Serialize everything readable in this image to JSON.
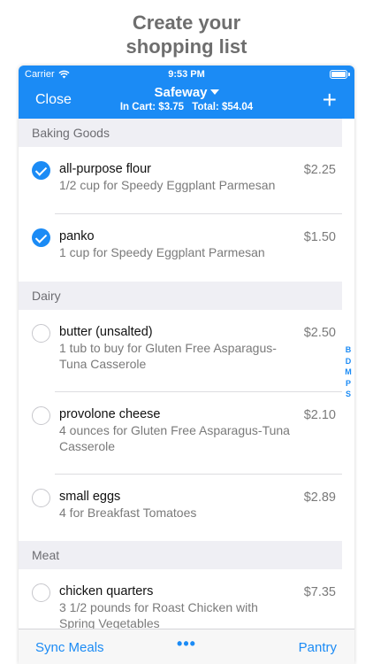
{
  "promo": {
    "line1": "Create your",
    "line2": "shopping list"
  },
  "status": {
    "carrier": "Carrier",
    "time": "9:53 PM"
  },
  "nav": {
    "close_label": "Close",
    "store": "Safeway",
    "in_cart": "In Cart: $3.75",
    "total": "Total: $54.04",
    "add_label": "+"
  },
  "sections": [
    {
      "title": "Baking Goods",
      "items": [
        {
          "name": "all-purpose flour",
          "desc": "1/2 cup for Speedy Eggplant Parmesan",
          "price": "$2.25",
          "checked": true
        },
        {
          "name": "panko",
          "desc": "1 cup for Speedy Eggplant Parmesan",
          "price": "$1.50",
          "checked": true
        }
      ]
    },
    {
      "title": "Dairy",
      "items": [
        {
          "name": "butter (unsalted)",
          "desc": "1 tub to buy for Gluten Free Asparagus-Tuna Casserole",
          "price": "$2.50",
          "checked": false
        },
        {
          "name": "provolone cheese",
          "desc": "4 ounces for Gluten Free Asparagus-Tuna Casserole",
          "price": "$2.10",
          "checked": false
        },
        {
          "name": "small eggs",
          "desc": "4 for Breakfast Tomatoes",
          "price": "$2.89",
          "checked": false
        }
      ]
    },
    {
      "title": "Meat",
      "items": [
        {
          "name": "chicken quarters",
          "desc": "3 1/2 pounds for Roast Chicken with Spring Vegetables",
          "price": "$7.35",
          "checked": false
        }
      ]
    }
  ],
  "index_letters": [
    "B",
    "D",
    "M",
    "P",
    "S"
  ],
  "toolbar": {
    "left": "Sync Meals",
    "middle": "•••",
    "right": "Pantry"
  },
  "colors": {
    "accent": "#1b8bf5",
    "section_bg": "#efeff4"
  }
}
